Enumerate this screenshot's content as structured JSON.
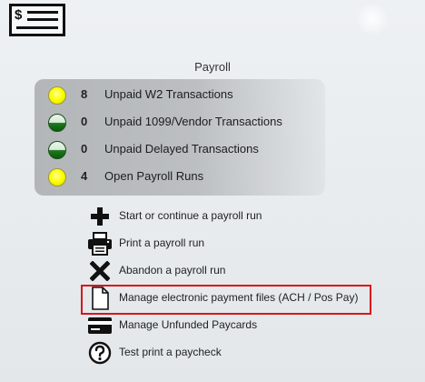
{
  "header": {
    "title": "Payroll"
  },
  "summary": [
    {
      "count": "8",
      "label": "Unpaid W2 Transactions",
      "status": "yellow"
    },
    {
      "count": "0",
      "label": "Unpaid 1099/Vendor Transactions",
      "status": "green"
    },
    {
      "count": "0",
      "label": "Unpaid Delayed Transactions",
      "status": "green"
    },
    {
      "count": "4",
      "label": "Open Payroll Runs",
      "status": "yellow"
    }
  ],
  "actions": [
    {
      "label": "Start or continue a payroll run",
      "icon": "plus-icon"
    },
    {
      "label": "Print a payroll run",
      "icon": "printer-icon"
    },
    {
      "label": "Abandon a payroll run",
      "icon": "x-icon"
    },
    {
      "label": "Manage electronic payment files (ACH / Pos Pay)",
      "icon": "document-icon",
      "highlighted": true
    },
    {
      "label": "Manage Unfunded Paycards",
      "icon": "credit-card-icon"
    },
    {
      "label": "Test print a paycheck",
      "icon": "question-circle-icon"
    }
  ],
  "colors": {
    "highlight": "#d9151b",
    "yellow": "#ffff00",
    "green": "#1e7a1e"
  }
}
